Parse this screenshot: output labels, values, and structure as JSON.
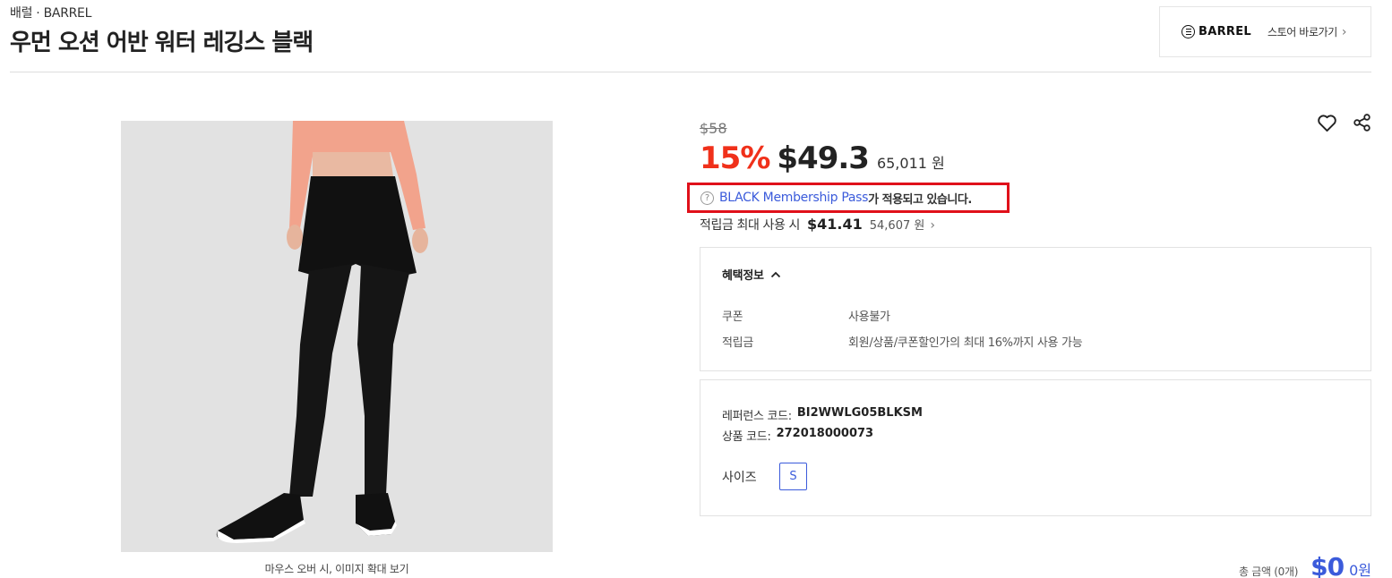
{
  "header": {
    "breadcrumb": "배럴 · BARREL",
    "title": "우먼 오션 어반 워터 레깅스 블랙"
  },
  "store": {
    "logo_text": "BARREL",
    "link_label": "스토어 바로가기",
    "chevron": "›"
  },
  "image": {
    "caption": "마우스 오버 시, 이미지 확대 보기"
  },
  "pricing": {
    "original": "$58",
    "discount": "15%",
    "sale": "$49.3",
    "sale_won": "65,011 원"
  },
  "membership": {
    "help_glyph": "?",
    "link": "BLACK Membership Pass",
    "suffix": "가 적용되고 있습니다."
  },
  "points": {
    "label": "적립금 최대 사용 시",
    "usd": "$41.41",
    "won": "54,607 원",
    "chevron": "›"
  },
  "benefits": {
    "title": "혜택정보",
    "rows": [
      {
        "key": "쿠폰",
        "value": "사용불가"
      },
      {
        "key": "적립금",
        "value": "회원/상품/쿠폰할인가의 최대 16%까지 사용 가능"
      }
    ]
  },
  "details": {
    "reference_label": "레퍼런스 코드:",
    "reference_value": "BI2WWLG05BLKSM",
    "product_code_label": "상품 코드:",
    "product_code_value": "272018000073",
    "size_label": "사이즈",
    "sizes": [
      "S"
    ]
  },
  "total": {
    "label": "총 금액 (0개)",
    "usd": "$0",
    "won": "0원"
  },
  "colors": {
    "discount_red": "#f0301a",
    "accent_blue": "#3b5bdb",
    "highlight_box": "#e0101a"
  },
  "icons": [
    "heart-icon",
    "share-icon",
    "help-circle-icon",
    "chevron-right-icon",
    "caret-up-icon"
  ]
}
